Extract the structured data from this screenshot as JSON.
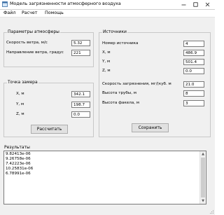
{
  "window": {
    "title": "Модель загрязненности атмосферного воздуха"
  },
  "menu": [
    "Файл",
    "Расчет",
    "Помощь"
  ],
  "atmosphere": {
    "title": "Параметры атмосферы",
    "wind_speed_label": "Скорость ветра, м/с",
    "wind_speed_value": "5.32",
    "wind_dir_label": "Направление ветра, градус",
    "wind_dir_value": "221"
  },
  "measure_point": {
    "title": "Точка замера",
    "x_label": "X, м",
    "x_value": "342.1",
    "y_label": "Y, м",
    "y_value": "198.7",
    "z_label": "Z, м",
    "z_value": "0.0",
    "calc_button": "Рассчитать"
  },
  "sources": {
    "title": "Источники",
    "number_label": "Номер источника",
    "number_value": "4",
    "x_label": "X, м",
    "x_value": "486.9",
    "y_label": "Y, м",
    "y_value": "501.4",
    "z_label": "Z, м",
    "z_value": "0.0",
    "rate_label": "Скорость загрязнения, мг/(куб. м",
    "rate_value": "21.0",
    "pipe_label": "Высота трубы, м",
    "pipe_value": "8",
    "torch_label": "Высота факела, м",
    "torch_value": "3",
    "save_button": "Сохранить"
  },
  "results": {
    "title": "Результаты",
    "lines": [
      "9.82413e-06",
      "9.26758e-06",
      "7.42223e-06",
      "10.25831e-06",
      "6.78991e-06"
    ]
  }
}
